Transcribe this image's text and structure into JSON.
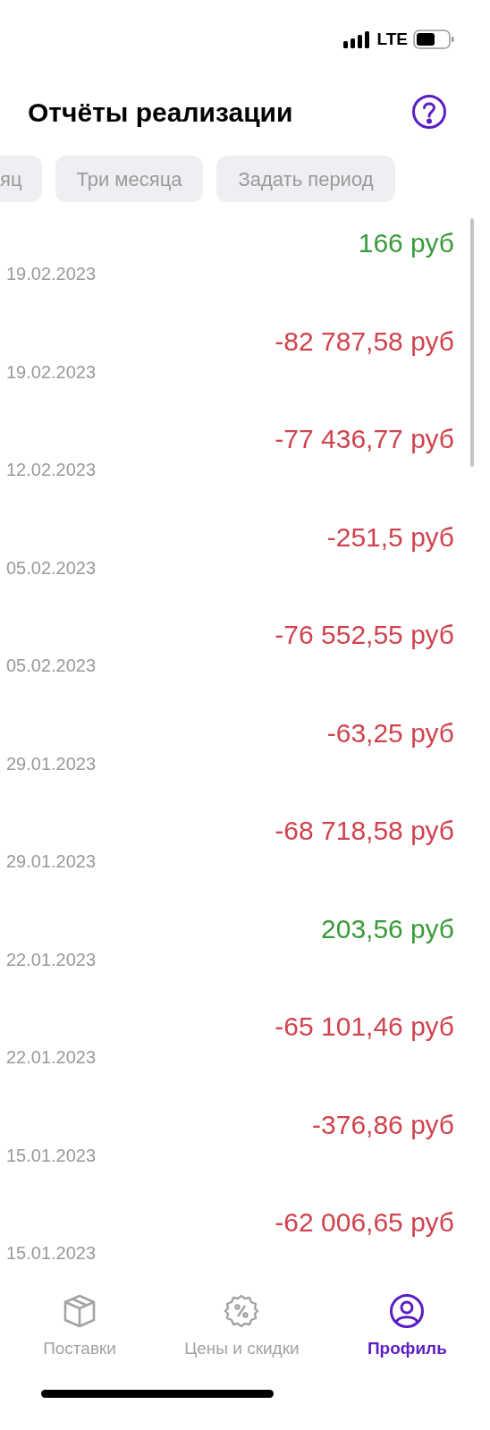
{
  "status_bar": {
    "network": "LTE"
  },
  "header": {
    "title": "Отчёты реализации"
  },
  "periods": [
    {
      "label": "яц",
      "selected": false
    },
    {
      "label": "Три месяца",
      "selected": false
    },
    {
      "label": "Задать период",
      "selected": false
    }
  ],
  "reports": [
    {
      "amount": "166 руб",
      "date": "19.02.2023",
      "kind": "income"
    },
    {
      "amount": "-82 787,58 руб",
      "date": "19.02.2023",
      "kind": "expense"
    },
    {
      "amount": "-77 436,77 руб",
      "date": "12.02.2023",
      "kind": "expense"
    },
    {
      "amount": "-251,5 руб",
      "date": "05.02.2023",
      "kind": "expense"
    },
    {
      "amount": "-76 552,55 руб",
      "date": "05.02.2023",
      "kind": "expense"
    },
    {
      "amount": "-63,25 руб",
      "date": "29.01.2023",
      "kind": "expense"
    },
    {
      "amount": "-68 718,58 руб",
      "date": "29.01.2023",
      "kind": "expense"
    },
    {
      "amount": "203,56 руб",
      "date": "22.01.2023",
      "kind": "income"
    },
    {
      "amount": "-65 101,46 руб",
      "date": "22.01.2023",
      "kind": "expense"
    },
    {
      "amount": "-376,86 руб",
      "date": "15.01.2023",
      "kind": "expense"
    },
    {
      "amount": "-62 006,65 руб",
      "date": "15.01.2023",
      "kind": "expense"
    }
  ],
  "tab_bar": [
    {
      "label": "Поставки",
      "kind": "box",
      "selected": false
    },
    {
      "label": "Цены и скидки",
      "kind": "discount",
      "selected": false
    },
    {
      "label": "Профиль",
      "kind": "profile",
      "selected": true
    }
  ]
}
